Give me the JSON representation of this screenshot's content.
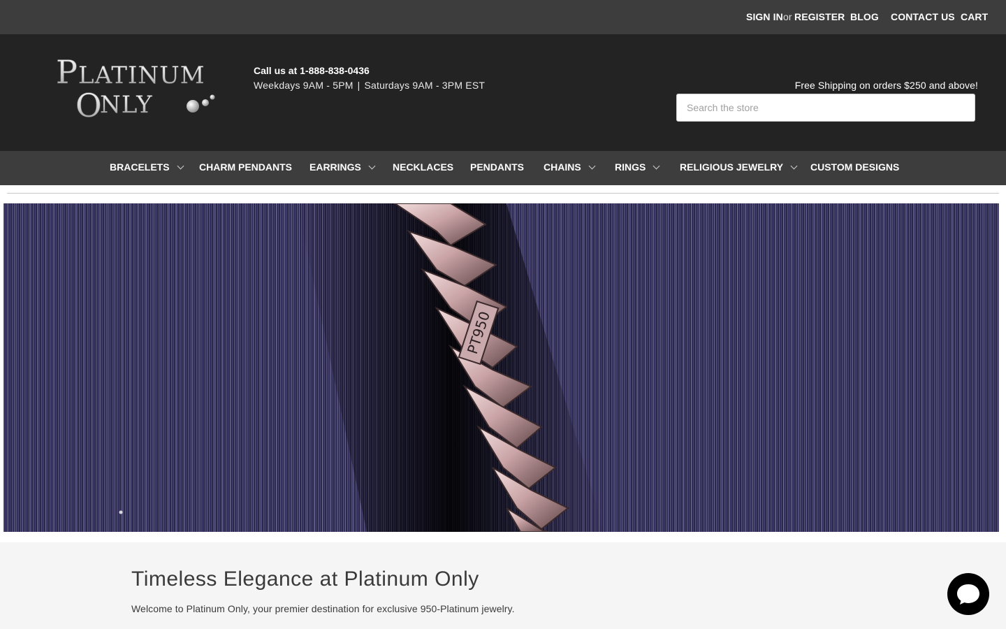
{
  "topbar": {
    "sign_in": "SIGN IN",
    "or": "or",
    "register": "REGISTER",
    "blog": "BLOG",
    "contact": "CONTACT US",
    "cart": "CART"
  },
  "header": {
    "logo_text_line1": "Platinum",
    "logo_text_line2": "Only",
    "phone": "Call us at 1-888-838-0436",
    "hours_weekdays": "Weekdays 9AM - 5PM",
    "hours_separator": "|",
    "hours_saturday": "Saturdays 9AM - 3PM EST",
    "shipping": "Free Shipping on orders $250 and above!",
    "search_placeholder": "Search the store"
  },
  "nav": {
    "items": [
      {
        "label": "BRACELETS",
        "has_dropdown": true
      },
      {
        "label": "CHARM PENDANTS",
        "has_dropdown": false
      },
      {
        "label": "EARRINGS",
        "has_dropdown": true
      },
      {
        "label": "NECKLACES",
        "has_dropdown": false
      },
      {
        "label": "PENDANTS",
        "has_dropdown": false
      },
      {
        "label": "CHAINS",
        "has_dropdown": true
      },
      {
        "label": "RINGS",
        "has_dropdown": true
      },
      {
        "label": "RELIGIOUS JEWELRY",
        "has_dropdown": true
      },
      {
        "label": "CUSTOM DESIGNS",
        "has_dropdown": false
      }
    ]
  },
  "hero": {
    "stamp_text": "PT950"
  },
  "main": {
    "heading": "Timeless Elegance at Platinum Only",
    "welcome": "Welcome to Platinum Only, your premier destination for exclusive 950-Platinum jewelry."
  },
  "colors": {
    "topbar": "#3d3d3d",
    "header": "#232323",
    "nav": "#3d3d3d",
    "hero_fabric": "#2a2546",
    "chat_button": "#000000"
  },
  "icons": {
    "chevron": "chevron-down-icon",
    "chat": "chat-bubble-icon"
  }
}
